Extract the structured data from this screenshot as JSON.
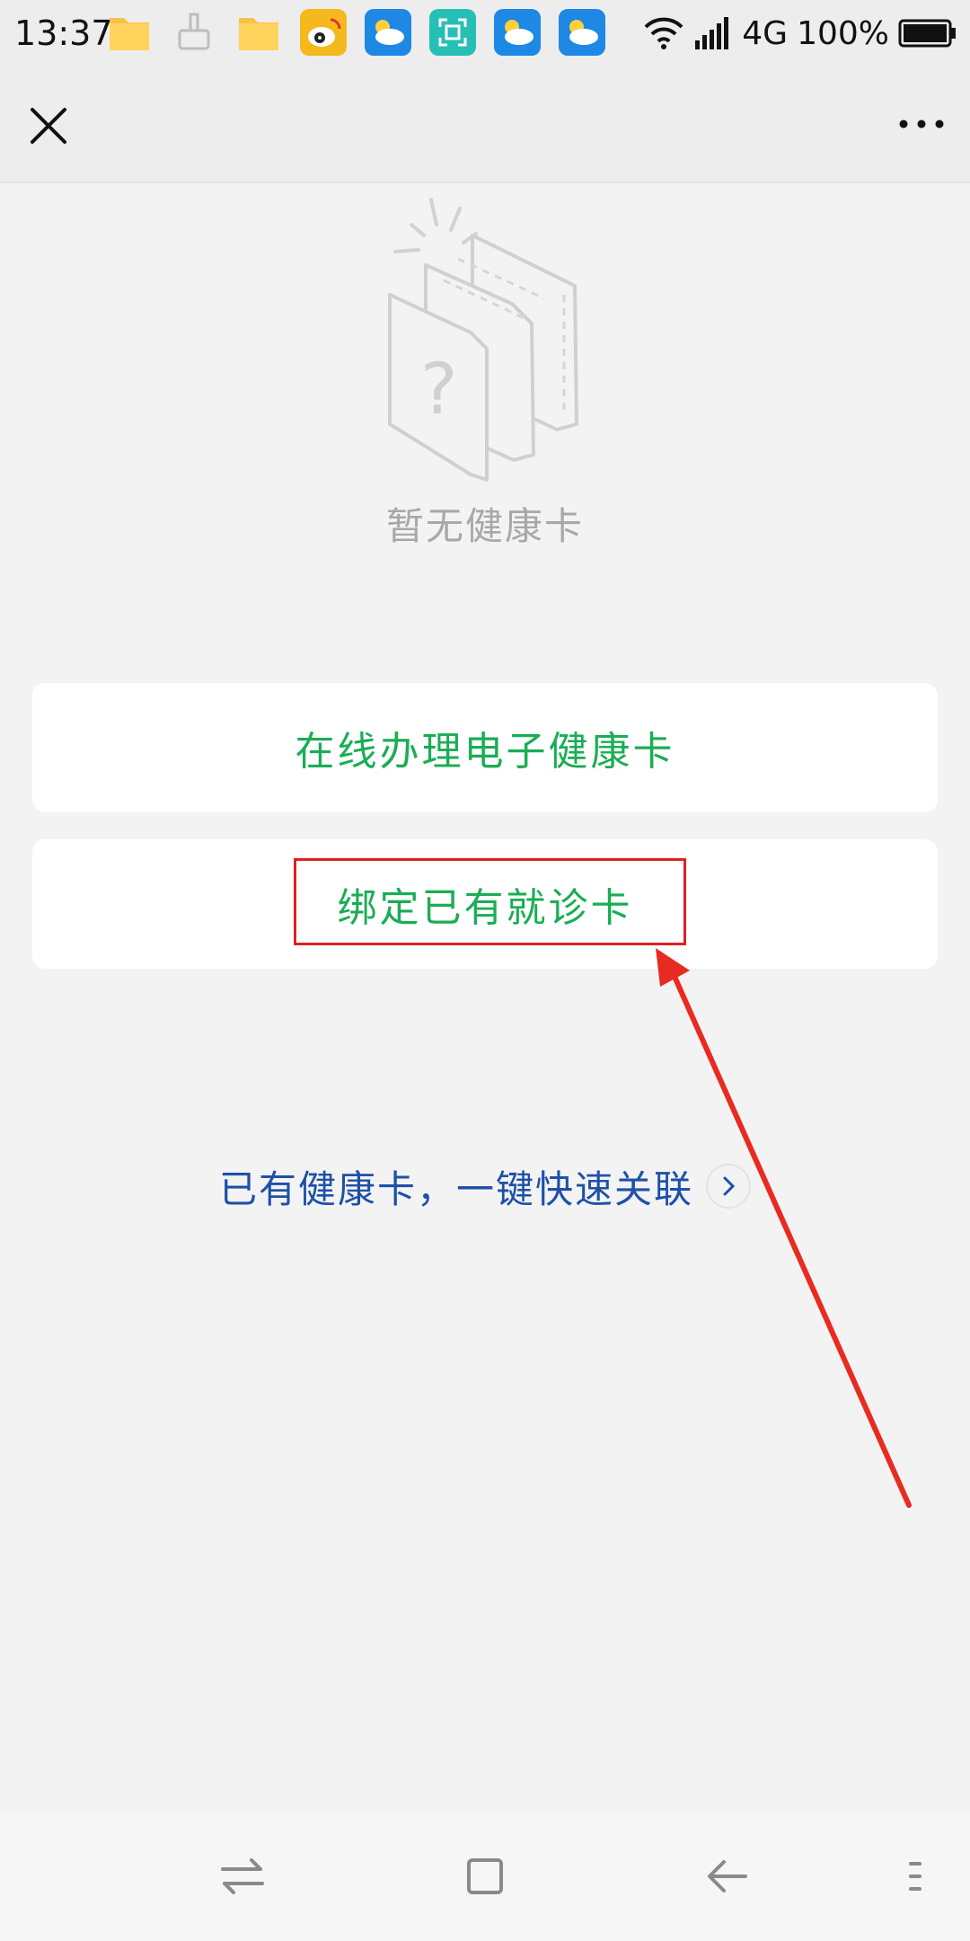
{
  "status_bar": {
    "time": "13:37",
    "network": "4G",
    "battery": "100%",
    "notification_icons": [
      "folder-icon",
      "broom-icon",
      "folder-icon",
      "weibo-icon",
      "weather-icon",
      "scanner-icon",
      "weather-icon",
      "weather-icon"
    ]
  },
  "title_bar": {
    "close_icon": "close-icon",
    "more_icon": "more-icon"
  },
  "empty_state": {
    "message": "暂无健康卡"
  },
  "actions": {
    "online_apply_label": "在线办理电子健康卡",
    "bind_card_label": "绑定已有就诊卡"
  },
  "quick_link": {
    "label": "已有健康卡，一键快速关联"
  },
  "nav_bar": {
    "icons": [
      "switch-icon",
      "home-icon",
      "back-icon",
      "menu-icon"
    ]
  },
  "colors": {
    "action_green": "#1aad55",
    "link_blue": "#1e50a8",
    "annotation_red": "#e02020",
    "empty_grey": "#a8a8a8"
  }
}
